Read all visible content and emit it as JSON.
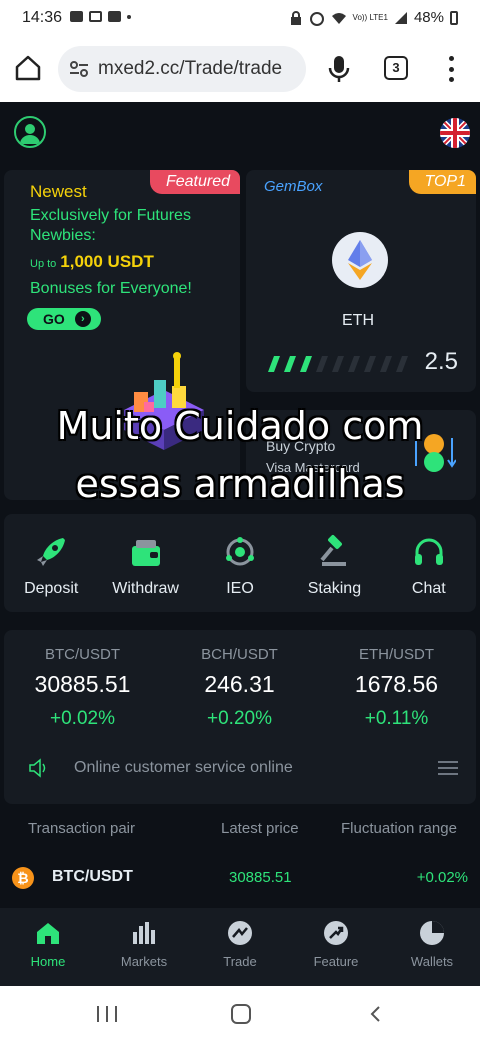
{
  "status_bar": {
    "time": "14:36",
    "network": "Vo)) LTE1",
    "battery": "48%"
  },
  "browser": {
    "url": "mxed2.cc/Trade/trade",
    "tab_count": "3"
  },
  "promo": {
    "featured_badge": "Featured",
    "newest": "Newest",
    "exclusive": "Exclusively for Futures Newbies:",
    "up_to": "Up to",
    "amount": "1,000 USDT",
    "bonuses": "Bonuses for Everyone!",
    "go_label": "GO"
  },
  "gembox": {
    "title": "GemBox",
    "badge": "TOP1",
    "coin": "ETH",
    "value": "2.5",
    "progress_segments_filled": 3
  },
  "buy_crypto": {
    "title": "Buy Crypto",
    "subtitle": "Visa  Mastercard"
  },
  "overlay": {
    "line1": "Muito Cuidado com",
    "line2": "essas armadilhas"
  },
  "actions": [
    {
      "label": "Deposit",
      "icon": "rocket-icon"
    },
    {
      "label": "Withdraw",
      "icon": "wallet-icon"
    },
    {
      "label": "IEO",
      "icon": "ieo-icon"
    },
    {
      "label": "Staking",
      "icon": "hammer-icon"
    },
    {
      "label": "Chat",
      "icon": "headset-icon"
    }
  ],
  "tickers": [
    {
      "pair": "BTC/USDT",
      "price": "30885.51",
      "change": "+0.02%"
    },
    {
      "pair": "BCH/USDT",
      "price": "246.31",
      "change": "+0.20%"
    },
    {
      "pair": "ETH/USDT",
      "price": "1678.56",
      "change": "+0.11%"
    }
  ],
  "service_notice": "Online customer service online",
  "table": {
    "headers": [
      "Transaction pair",
      "Latest price",
      "Fluctuation range"
    ],
    "rows": [
      {
        "pair": "BTC/USDT",
        "price": "30885.51",
        "change": "+0.02%",
        "coin_symbol": "₿"
      }
    ]
  },
  "tabs": [
    {
      "label": "Home",
      "icon": "home-icon",
      "active": true
    },
    {
      "label": "Markets",
      "icon": "markets-icon",
      "active": false
    },
    {
      "label": "Trade",
      "icon": "trade-icon",
      "active": false
    },
    {
      "label": "Feature",
      "icon": "feature-icon",
      "active": false
    },
    {
      "label": "Wallets",
      "icon": "wallets-icon",
      "active": false
    }
  ],
  "colors": {
    "accent": "#2ee37a",
    "background": "#0d1117",
    "card": "#161b22",
    "featured": "#e84a5f",
    "top1": "#f5a623",
    "gold": "#f5d20a"
  }
}
